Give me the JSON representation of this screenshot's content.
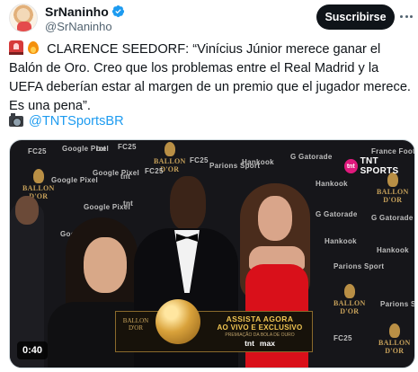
{
  "author": {
    "display_name": "SrNaninho",
    "handle": "@SrNaninho",
    "verified": true,
    "avatar_icon": "avatar-icon"
  },
  "actions": {
    "subscribe_label": "Suscribirse",
    "more_icon": "more-options-icon"
  },
  "tweet": {
    "emojis": [
      "siren-icon",
      "fire-icon"
    ],
    "text": "CLARENCE SEEDORF: “Vinícius Júnior merece ganar el Balón de Oro. Creo que los problemas entre el Real Madrid y la UEFA deberían estar al margen de un premio que el jugador merece. Es una pena”.",
    "source_icon": "camera-icon",
    "source_link": "@TNTSportsBR"
  },
  "video": {
    "duration": "0:40",
    "channel_logo": "TNT SPORTS",
    "channel_badge": "tnt",
    "backdrop_logos": [
      "FC25",
      "Google Pixel",
      "Hankook",
      "Gatorade",
      "Parions Sport",
      "France Football",
      "tnt"
    ],
    "ballon_dor_label": "BALLON D'OR",
    "banner": {
      "line1": "ASSISTA AGORA",
      "line2": "AO VIVO E EXCLUSIVO",
      "line3": "PREMIAÇÃO DA BOLA DE OURO",
      "brand_left": "tnt",
      "brand_right": "max"
    }
  },
  "colors": {
    "link": "#1d9bf0",
    "verified": "#1d9bf0",
    "button_bg": "#0f1419",
    "banner_gold": "#f0c552"
  }
}
